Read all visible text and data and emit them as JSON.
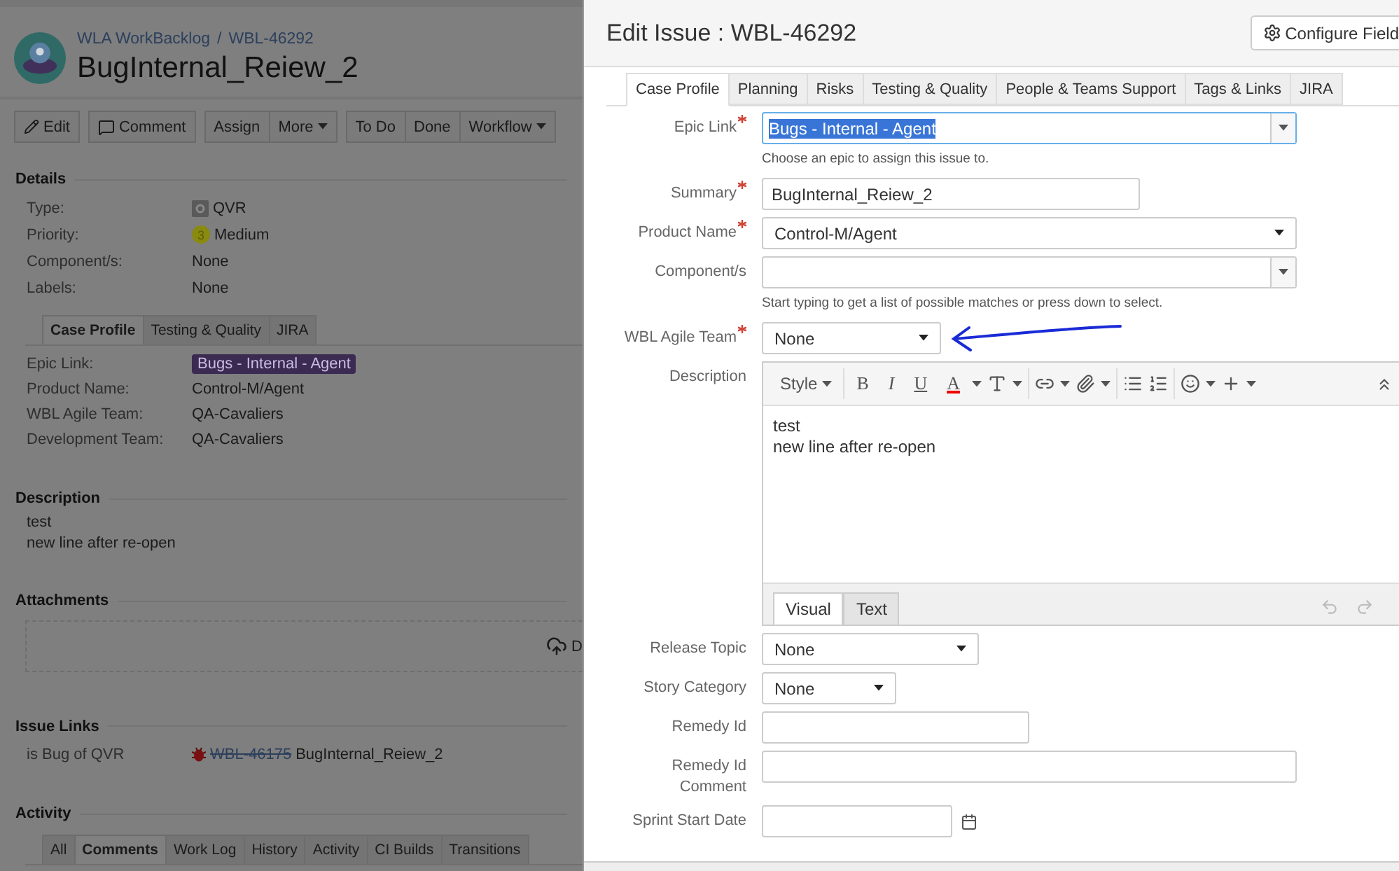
{
  "issue_page": {
    "breadcrumbs": [
      "WLA WorkBacklog",
      "WBL-46292"
    ],
    "separator": "/",
    "title": "BugInternal_Reiew_2",
    "toolbar": [
      {
        "buttons": [
          {
            "label": "Edit",
            "dropdown": false
          }
        ]
      },
      {
        "buttons": [
          {
            "label": "Comment",
            "dropdown": false
          }
        ]
      },
      {
        "buttons": [
          {
            "label": "Assign",
            "dropdown": false
          },
          {
            "label": "More",
            "dropdown": true
          }
        ]
      },
      {
        "buttons": [
          {
            "label": "To Do",
            "dropdown": false
          },
          {
            "label": "Done",
            "dropdown": false
          },
          {
            "label": "Workflow",
            "dropdown": true
          }
        ]
      }
    ],
    "details": {
      "heading": "Details",
      "fields": [
        {
          "label": "Type:",
          "value": "QVR",
          "kind": "type"
        },
        {
          "label": "Priority:",
          "value": "Medium",
          "kind": "priority",
          "badge": "3"
        },
        {
          "label": "Component/s:",
          "value": "None",
          "kind": "plain"
        },
        {
          "label": "Labels:",
          "value": "None",
          "kind": "plain"
        }
      ]
    },
    "custom_tabs": [
      {
        "label": "Case Profile",
        "selected": true
      },
      {
        "label": "Testing & Quality",
        "selected": false
      },
      {
        "label": "JIRA",
        "selected": false
      }
    ],
    "custom_fields": [
      {
        "label": "Epic Link:",
        "value": "Bugs - Internal - Agent",
        "kind": "lozenge"
      },
      {
        "label": "Product Name:",
        "value": "Control-M/Agent",
        "kind": "plain"
      },
      {
        "label": "WBL Agile Team:",
        "value": "QA-Cavaliers",
        "kind": "plain"
      },
      {
        "label": "Development Team:",
        "value": "QA-Cavaliers",
        "kind": "plain"
      }
    ],
    "description": {
      "heading": "Description",
      "lines": [
        "test",
        "new line after re-open"
      ]
    },
    "attachments": {
      "heading": "Attachments",
      "drop_text": "D"
    },
    "issue_links": {
      "heading": "Issue Links",
      "links": [
        {
          "relation": "is Bug of QVR",
          "key": "WBL-46175",
          "summary": "BugInternal_Reiew_2",
          "resolved": true
        }
      ]
    },
    "activity": {
      "heading": "Activity",
      "tabs": [
        {
          "label": "All",
          "selected": false
        },
        {
          "label": "Comments",
          "selected": true
        },
        {
          "label": "Work Log",
          "selected": false
        },
        {
          "label": "History",
          "selected": false
        },
        {
          "label": "Activity",
          "selected": false
        },
        {
          "label": "CI Builds",
          "selected": false
        },
        {
          "label": "Transitions",
          "selected": false
        }
      ]
    }
  },
  "dialog": {
    "title": "Edit Issue : WBL-46292",
    "configure_button": "Configure Field",
    "tabs": [
      {
        "label": "Case Profile",
        "selected": true
      },
      {
        "label": "Planning",
        "selected": false
      },
      {
        "label": "Risks",
        "selected": false
      },
      {
        "label": "Testing & Quality",
        "selected": false
      },
      {
        "label": "People & Teams Support",
        "selected": false
      },
      {
        "label": "Tags & Links",
        "selected": false
      },
      {
        "label": "JIRA",
        "selected": false
      }
    ],
    "fields": [
      {
        "label": "Epic Link",
        "required": true,
        "kind": "combo",
        "value": "Bugs - Internal - Agent",
        "highlighted": true,
        "hint": "Choose an epic to assign this issue to."
      },
      {
        "label": "Summary",
        "required": true,
        "kind": "text",
        "value": "BugInternal_Reiew_2"
      },
      {
        "label": "Product Name",
        "required": true,
        "kind": "select",
        "value": "Control-M/Agent"
      },
      {
        "label": "Component/s",
        "kind": "combo",
        "highlighted": false,
        "hint": "Start typing to get a list of possible matches or press down to select."
      },
      {
        "label": "WBL Agile Team",
        "required": true,
        "kind": "select",
        "value": "None",
        "annotated": true
      },
      {
        "label": "Description",
        "kind": "editor",
        "style_menu": "Style",
        "format_buttons": [
          "B",
          "I",
          "U",
          "A"
        ],
        "lines": [
          "test",
          "new line after re-open"
        ],
        "modes": [
          {
            "label": "Visual",
            "selected": true
          },
          {
            "label": "Text",
            "selected": false
          }
        ]
      },
      {
        "label": "Release Topic",
        "kind": "select",
        "value": "None"
      },
      {
        "label": "Story Category",
        "kind": "select",
        "value": "None"
      },
      {
        "label": "Remedy Id",
        "kind": "text"
      },
      {
        "label": "Remedy Id Comment",
        "kind": "text"
      },
      {
        "label": "Sprint Start Date",
        "kind": "date"
      }
    ]
  }
}
